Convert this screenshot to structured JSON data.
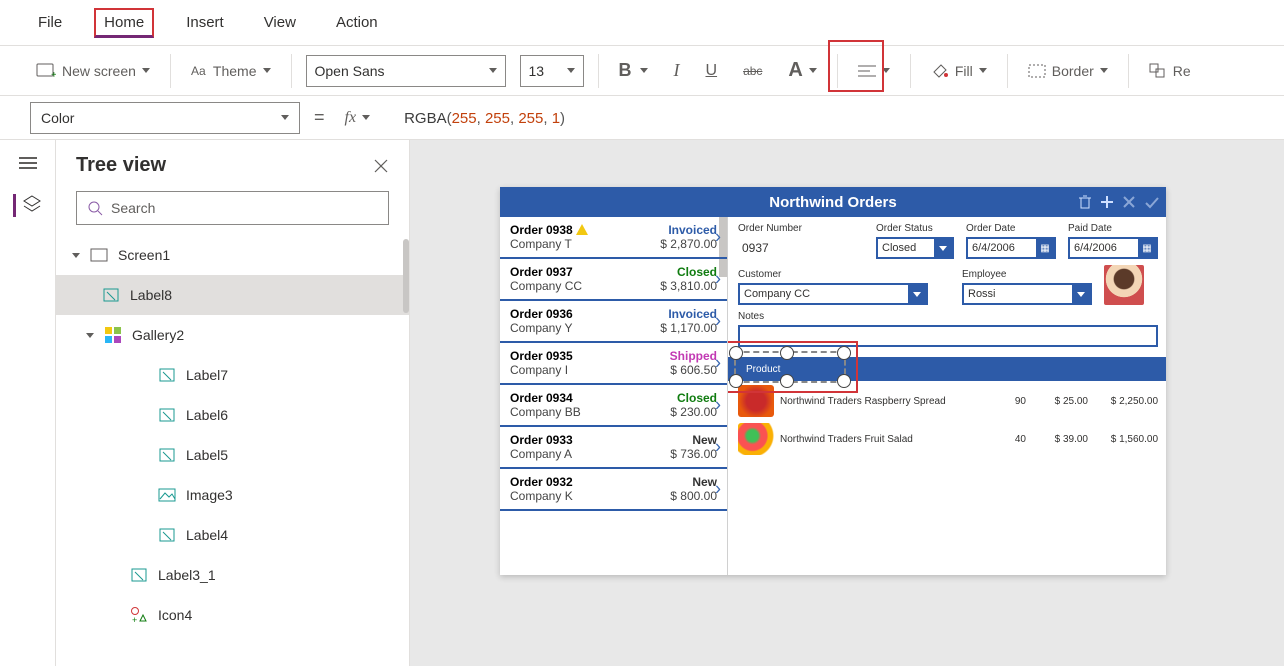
{
  "menu": {
    "file": "File",
    "home": "Home",
    "insert": "Insert",
    "view": "View",
    "action": "Action"
  },
  "ribbon": {
    "new_screen": "New screen",
    "theme": "Theme",
    "font": "Open Sans",
    "size": "13",
    "fill": "Fill",
    "border": "Border",
    "reorder_stub": "Re"
  },
  "formula": {
    "property": "Color",
    "expr_fn": "RGBA",
    "a1": "255",
    "a2": "255",
    "a3": "255",
    "a4": "1"
  },
  "tree": {
    "title": "Tree view",
    "search_ph": "Search",
    "nodes": {
      "screen": "Screen1",
      "label8": "Label8",
      "gallery2": "Gallery2",
      "label7": "Label7",
      "label6": "Label6",
      "label5": "Label5",
      "image3": "Image3",
      "label4": "Label4",
      "label3_1": "Label3_1",
      "icon4": "Icon4"
    }
  },
  "app": {
    "title": "Northwind Orders",
    "orders": [
      {
        "id": "Order 0938",
        "company": "Company T",
        "status": "Invoiced",
        "amount": "$ 2,870.00",
        "warn": true
      },
      {
        "id": "Order 0937",
        "company": "Company CC",
        "status": "Closed",
        "amount": "$ 3,810.00"
      },
      {
        "id": "Order 0936",
        "company": "Company Y",
        "status": "Invoiced",
        "amount": "$ 1,170.00"
      },
      {
        "id": "Order 0935",
        "company": "Company I",
        "status": "Shipped",
        "amount": "$ 606.50"
      },
      {
        "id": "Order 0934",
        "company": "Company BB",
        "status": "Closed",
        "amount": "$ 230.00"
      },
      {
        "id": "Order 0933",
        "company": "Company A",
        "status": "New",
        "amount": "$ 736.00"
      },
      {
        "id": "Order 0932",
        "company": "Company K",
        "status": "New",
        "amount": "$ 800.00"
      }
    ],
    "detail": {
      "labels": {
        "ordnum": "Order Number",
        "ordstat": "Order Status",
        "orddate": "Order Date",
        "paiddate": "Paid Date",
        "customer": "Customer",
        "employee": "Employee",
        "notes": "Notes",
        "product": "Product"
      },
      "ordnum": "0937",
      "ordstat": "Closed",
      "orddate": "6/4/2006",
      "paiddate": "6/4/2006",
      "customer": "Company CC",
      "employee": "Rossi"
    },
    "products": [
      {
        "name": "Northwind Traders Raspberry Spread",
        "qty": "90",
        "price": "$ 25.00",
        "total": "$ 2,250.00"
      },
      {
        "name": "Northwind Traders Fruit Salad",
        "qty": "40",
        "price": "$ 39.00",
        "total": "$ 1,560.00"
      }
    ]
  }
}
